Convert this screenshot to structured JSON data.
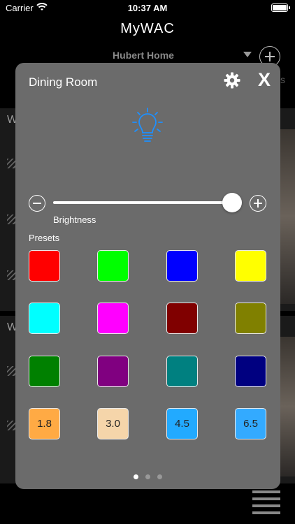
{
  "status_bar": {
    "carrier": "Carrier",
    "time": "10:37 AM"
  },
  "app": {
    "title": "MyWAC"
  },
  "home": {
    "name": "Hubert Home"
  },
  "background": {
    "room_letter_1": "W",
    "room_letter_2": "W",
    "side_text": "s"
  },
  "modal": {
    "title": "Dining Room",
    "close_label": "X",
    "brightness_label": "Brightness",
    "brightness_level": 1.0,
    "presets_label": "Presets",
    "presets": [
      {
        "color": "#FF0000",
        "label": ""
      },
      {
        "color": "#00FF00",
        "label": ""
      },
      {
        "color": "#0000FF",
        "label": ""
      },
      {
        "color": "#FFFF00",
        "label": ""
      },
      {
        "color": "#00FFFF",
        "label": ""
      },
      {
        "color": "#FF00FF",
        "label": ""
      },
      {
        "color": "#800000",
        "label": ""
      },
      {
        "color": "#808000",
        "label": ""
      },
      {
        "color": "#008000",
        "label": ""
      },
      {
        "color": "#800080",
        "label": ""
      },
      {
        "color": "#008080",
        "label": ""
      },
      {
        "color": "#000080",
        "label": ""
      },
      {
        "color": "#FFAA44",
        "label": "1.8"
      },
      {
        "color": "#F5D5AA",
        "label": "3.0"
      },
      {
        "color": "#22AAFF",
        "label": "4.5"
      },
      {
        "color": "#33AAFF",
        "label": "6.5"
      }
    ],
    "page_count": 3,
    "current_page": 1
  },
  "colors": {
    "accent": "#1E90FF",
    "modal_bg": "#6B6B6B"
  }
}
